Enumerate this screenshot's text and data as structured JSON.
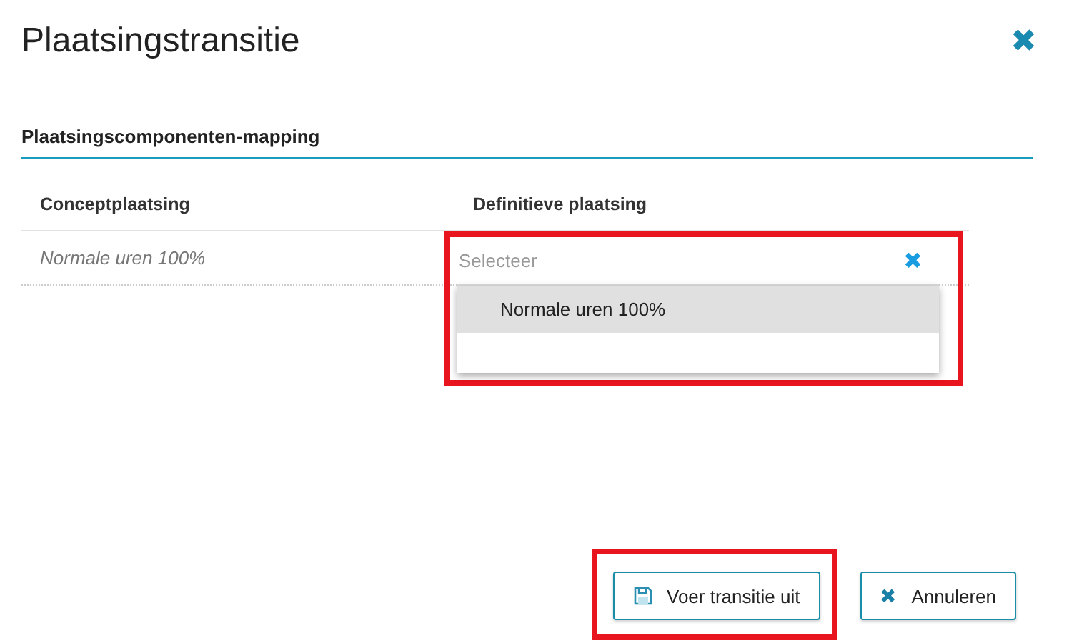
{
  "dialog": {
    "title": "Plaatsingstransitie",
    "close_icon": "✖"
  },
  "section": {
    "title": "Plaatsingscomponenten-mapping"
  },
  "table": {
    "columns": [
      "Conceptplaatsing",
      "Definitieve plaatsing"
    ],
    "rows": [
      {
        "concept": "Normale uren 100%",
        "select": {
          "placeholder": "Selecteer",
          "clear_icon": "✖",
          "highlighted": true,
          "expanded": true,
          "options": [
            {
              "label": "Normale uren 100%",
              "selected": true
            }
          ]
        }
      }
    ]
  },
  "buttons": [
    {
      "kind": "save",
      "label": "Voer transitie uit",
      "highlighted": true
    },
    {
      "kind": "cancel",
      "label": "Annuleren",
      "icon": "✖",
      "highlighted": false
    }
  ]
}
